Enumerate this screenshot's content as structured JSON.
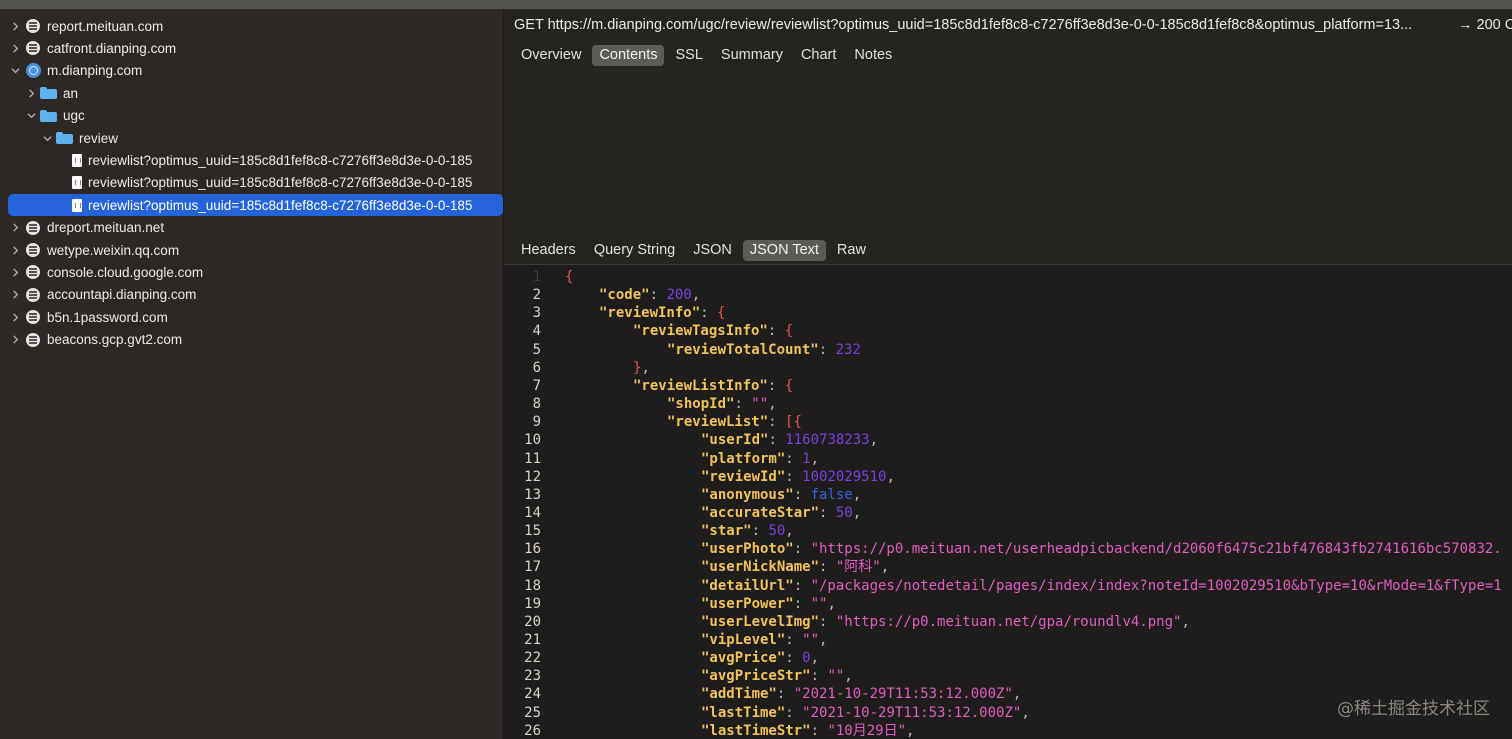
{
  "sidebar": {
    "items": [
      {
        "label": "report.meituan.com",
        "type": "host",
        "expanded": false
      },
      {
        "label": "catfront.dianping.com",
        "type": "host",
        "expanded": false
      },
      {
        "label": "m.dianping.com",
        "type": "globe",
        "expanded": true
      },
      {
        "label": "an",
        "type": "folder",
        "expanded": false
      },
      {
        "label": "ugc",
        "type": "folder",
        "expanded": true
      },
      {
        "label": "review",
        "type": "folder",
        "expanded": true
      },
      {
        "label": "reviewlist?optimus_uuid=185c8d1fef8c8-c7276ff3e8d3e-0-0-185",
        "type": "file"
      },
      {
        "label": "reviewlist?optimus_uuid=185c8d1fef8c8-c7276ff3e8d3e-0-0-185",
        "type": "file"
      },
      {
        "label": "reviewlist?optimus_uuid=185c8d1fef8c8-c7276ff3e8d3e-0-0-185",
        "type": "file",
        "selected": true
      },
      {
        "label": "dreport.meituan.net",
        "type": "host",
        "expanded": false
      },
      {
        "label": "wetype.weixin.qq.com",
        "type": "host",
        "expanded": false
      },
      {
        "label": "console.cloud.google.com",
        "type": "host",
        "expanded": false
      },
      {
        "label": "accountapi.dianping.com",
        "type": "host",
        "expanded": false
      },
      {
        "label": "b5n.1password.com",
        "type": "host",
        "expanded": false
      },
      {
        "label": "beacons.gcp.gvt2.com",
        "type": "host",
        "expanded": false
      }
    ]
  },
  "request": {
    "line": "GET https://m.dianping.com/ugc/review/reviewlist?optimus_uuid=185c8d1fef8c8-c7276ff3e8d3e-0-0-185c8d1fef8c8&optimus_platform=13...",
    "status": "→ 200 C"
  },
  "top_tabs": [
    {
      "label": "Overview"
    },
    {
      "label": "Contents",
      "active": true
    },
    {
      "label": "SSL"
    },
    {
      "label": "Summary"
    },
    {
      "label": "Chart"
    },
    {
      "label": "Notes"
    }
  ],
  "sub_tabs": [
    {
      "label": "Headers"
    },
    {
      "label": "Query String"
    },
    {
      "label": "JSON"
    },
    {
      "label": "JSON Text",
      "active": true
    },
    {
      "label": "Raw"
    }
  ],
  "code_lines": [
    {
      "n": "1",
      "indent": 0,
      "tokens": [
        [
          "p",
          "{"
        ]
      ]
    },
    {
      "n": "2",
      "indent": 1,
      "tokens": [
        [
          "k",
          "\"code\""
        ],
        [
          "c",
          ": "
        ],
        [
          "n",
          "200"
        ],
        [
          "c",
          ","
        ]
      ]
    },
    {
      "n": "3",
      "indent": 1,
      "tokens": [
        [
          "k",
          "\"reviewInfo\""
        ],
        [
          "c",
          ": "
        ],
        [
          "p",
          "{"
        ]
      ]
    },
    {
      "n": "4",
      "indent": 2,
      "tokens": [
        [
          "k",
          "\"reviewTagsInfo\""
        ],
        [
          "c",
          ": "
        ],
        [
          "p",
          "{"
        ]
      ]
    },
    {
      "n": "5",
      "indent": 3,
      "tokens": [
        [
          "k",
          "\"reviewTotalCount\""
        ],
        [
          "c",
          ": "
        ],
        [
          "n",
          "232"
        ]
      ]
    },
    {
      "n": "6",
      "indent": 2,
      "tokens": [
        [
          "p",
          "}"
        ],
        [
          "c",
          ","
        ]
      ]
    },
    {
      "n": "7",
      "indent": 2,
      "tokens": [
        [
          "k",
          "\"reviewListInfo\""
        ],
        [
          "c",
          ": "
        ],
        [
          "p",
          "{"
        ]
      ]
    },
    {
      "n": "8",
      "indent": 3,
      "tokens": [
        [
          "k",
          "\"shopId\""
        ],
        [
          "c",
          ": "
        ],
        [
          "s",
          "\"\""
        ],
        [
          "c",
          ","
        ]
      ]
    },
    {
      "n": "9",
      "indent": 3,
      "tokens": [
        [
          "k",
          "\"reviewList\""
        ],
        [
          "c",
          ": "
        ],
        [
          "p",
          "[{"
        ]
      ]
    },
    {
      "n": "10",
      "indent": 4,
      "tokens": [
        [
          "k",
          "\"userId\""
        ],
        [
          "c",
          ": "
        ],
        [
          "n",
          "1160738233"
        ],
        [
          "c",
          ","
        ]
      ]
    },
    {
      "n": "11",
      "indent": 4,
      "tokens": [
        [
          "k",
          "\"platform\""
        ],
        [
          "c",
          ": "
        ],
        [
          "n",
          "1"
        ],
        [
          "c",
          ","
        ]
      ]
    },
    {
      "n": "12",
      "indent": 4,
      "tokens": [
        [
          "k",
          "\"reviewId\""
        ],
        [
          "c",
          ": "
        ],
        [
          "n",
          "1002029510"
        ],
        [
          "c",
          ","
        ]
      ]
    },
    {
      "n": "13",
      "indent": 4,
      "tokens": [
        [
          "k",
          "\"anonymous\""
        ],
        [
          "c",
          ": "
        ],
        [
          "b",
          "false"
        ],
        [
          "c",
          ","
        ]
      ]
    },
    {
      "n": "14",
      "indent": 4,
      "tokens": [
        [
          "k",
          "\"accurateStar\""
        ],
        [
          "c",
          ": "
        ],
        [
          "n",
          "50"
        ],
        [
          "c",
          ","
        ]
      ]
    },
    {
      "n": "15",
      "indent": 4,
      "tokens": [
        [
          "k",
          "\"star\""
        ],
        [
          "c",
          ": "
        ],
        [
          "n",
          "50"
        ],
        [
          "c",
          ","
        ]
      ]
    },
    {
      "n": "16",
      "indent": 4,
      "tokens": [
        [
          "k",
          "\"userPhoto\""
        ],
        [
          "c",
          ": "
        ],
        [
          "s",
          "\"https://p0.meituan.net/userheadpicbackend/d2060f6475c21bf476843fb2741616bc570832."
        ]
      ]
    },
    {
      "n": "17",
      "indent": 4,
      "tokens": [
        [
          "k",
          "\"userNickName\""
        ],
        [
          "c",
          ": "
        ],
        [
          "s",
          "\"阿科\""
        ],
        [
          "c",
          ","
        ]
      ]
    },
    {
      "n": "18",
      "indent": 4,
      "tokens": [
        [
          "k",
          "\"detailUrl\""
        ],
        [
          "c",
          ": "
        ],
        [
          "s",
          "\"/packages/notedetail/pages/index/index?noteId=1002029510&bType=10&rMode=1&fType=1"
        ]
      ]
    },
    {
      "n": "19",
      "indent": 4,
      "tokens": [
        [
          "k",
          "\"userPower\""
        ],
        [
          "c",
          ": "
        ],
        [
          "s",
          "\"\""
        ],
        [
          "c",
          ","
        ]
      ]
    },
    {
      "n": "20",
      "indent": 4,
      "tokens": [
        [
          "k",
          "\"userLevelImg\""
        ],
        [
          "c",
          ": "
        ],
        [
          "s",
          "\"https://p0.meituan.net/gpa/roundlv4.png\""
        ],
        [
          "c",
          ","
        ]
      ]
    },
    {
      "n": "21",
      "indent": 4,
      "tokens": [
        [
          "k",
          "\"vipLevel\""
        ],
        [
          "c",
          ": "
        ],
        [
          "s",
          "\"\""
        ],
        [
          "c",
          ","
        ]
      ]
    },
    {
      "n": "22",
      "indent": 4,
      "tokens": [
        [
          "k",
          "\"avgPrice\""
        ],
        [
          "c",
          ": "
        ],
        [
          "n",
          "0"
        ],
        [
          "c",
          ","
        ]
      ]
    },
    {
      "n": "23",
      "indent": 4,
      "tokens": [
        [
          "k",
          "\"avgPriceStr\""
        ],
        [
          "c",
          ": "
        ],
        [
          "s",
          "\"\""
        ],
        [
          "c",
          ","
        ]
      ]
    },
    {
      "n": "24",
      "indent": 4,
      "tokens": [
        [
          "k",
          "\"addTime\""
        ],
        [
          "c",
          ": "
        ],
        [
          "s",
          "\"2021-10-29T11:53:12.000Z\""
        ],
        [
          "c",
          ","
        ]
      ]
    },
    {
      "n": "25",
      "indent": 4,
      "tokens": [
        [
          "k",
          "\"lastTime\""
        ],
        [
          "c",
          ": "
        ],
        [
          "s",
          "\"2021-10-29T11:53:12.000Z\""
        ],
        [
          "c",
          ","
        ]
      ]
    },
    {
      "n": "26",
      "indent": 4,
      "tokens": [
        [
          "k",
          "\"lastTimeStr\""
        ],
        [
          "c",
          ": "
        ],
        [
          "s",
          "\"10月29日\""
        ],
        [
          "c",
          ","
        ]
      ]
    }
  ],
  "watermark": "@稀土掘金技术社区"
}
